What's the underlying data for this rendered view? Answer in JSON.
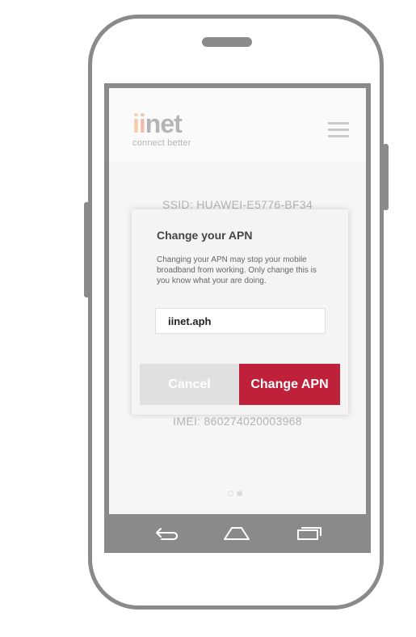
{
  "logo": {
    "word_part1": "i",
    "word_part2": "i",
    "word_part3": "net",
    "tagline": "connect better"
  },
  "header": {
    "menu_icon": "hamburger-menu-icon"
  },
  "device_info": {
    "ssid": "SSID: HUAWEI-E5776-BF34",
    "imei": "IMEI: 860274020003968"
  },
  "pager": {
    "total": 2,
    "active": 2
  },
  "dialog": {
    "title": "Change your APN",
    "message": "Changing your APN may stop your mobile broadband from working. Only change this is you know what your are doing.",
    "apn_value": "iinet.aph",
    "cancel_label": "Cancel",
    "confirm_label": "Change APN"
  },
  "nav_bar": {
    "icons": [
      "back-icon",
      "home-icon",
      "recent-apps-icon"
    ]
  },
  "colors": {
    "accent": "#c0213a",
    "frame": "#8a8a8a",
    "logo_orange": "#f0b37a",
    "logo_pink": "#e99a82"
  }
}
